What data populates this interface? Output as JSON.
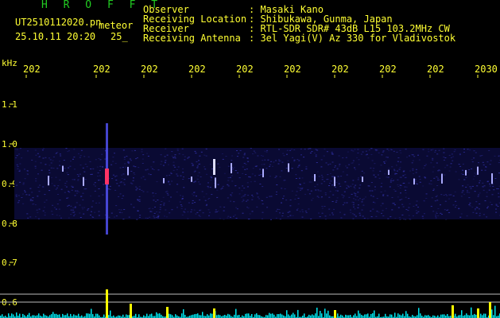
{
  "header": {
    "title": "H R O F F T",
    "file_name": "UT2510112020.pn",
    "file_type": "meteor",
    "date_time": "25.10.11 20:20",
    "count": "25_",
    "info_labels": [
      "Observer",
      "Receiving Location",
      "Receiver",
      "Receiving Antenna"
    ],
    "info_values": [
      ": Masaki Kano",
      ": Shibukawa, Gunma, Japan",
      ": RTL-SDR SDR# 43dB L15 103.2MHz CW",
      ": 3el Yagi(V) Az 330 for Vladivostok"
    ]
  },
  "axis": {
    "unit": "kHz",
    "x_ticks": [
      "202",
      "202",
      "202",
      "202",
      "202",
      "202",
      "202",
      "202",
      "202",
      "2030"
    ],
    "y_ticks": [
      "1.1",
      "1.0",
      "0.9",
      "0.8",
      "0.7",
      "0.6"
    ]
  },
  "colors": {
    "background": "#000000",
    "label": "#ffff33",
    "title": "#22cc22",
    "signal": "#ff3366",
    "band": "#3333aa",
    "level": "#00e5ee",
    "spike": "#ffff00"
  }
}
